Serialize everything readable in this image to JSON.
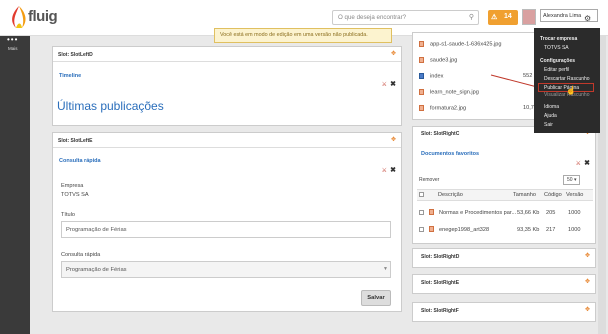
{
  "app": {
    "logo_text": "fluig"
  },
  "header": {
    "search_placeholder": "O que deseja encontrar?",
    "alerts_count": "14",
    "user_name": "Alexandra Lima"
  },
  "sidebar": {
    "dots": "•••",
    "label": "Mais"
  },
  "banner": {
    "text": "Você está em modo de edição em uma versão não publicada."
  },
  "slot_left_d": {
    "title": "Slot: SlotLeftD",
    "widget_title": "Timeline",
    "heading": "Últimas publicações"
  },
  "slot_left_e": {
    "title": "Slot: SlotLeftE",
    "widget_title": "Consulta rápida",
    "company_label": "Empresa",
    "company_value": "TOTVS SA",
    "title_label": "Título",
    "title_value": "Programação de Férias",
    "quick_label": "Consulta rápida",
    "quick_value": "Programação de Férias",
    "save_label": "Salvar"
  },
  "files": [
    "app-s1-saude-1-636x425.jpg",
    "saude3.jpg",
    "index",
    "learn_note_sign.jpg",
    "formatura2.jpg"
  ],
  "file_sizes": [
    "",
    "",
    "552",
    "",
    "10,7"
  ],
  "slot_right_c": {
    "title": "Slot: SlotRightC",
    "widget_title": "Documentos favoritos",
    "remove_label": "Remover",
    "page_size": "50",
    "columns": [
      "Descrição",
      "Tamanho",
      "Código",
      "Versão"
    ],
    "rows": [
      {
        "desc": "Normas e Procedimentos par...",
        "size": "53,66 Kb",
        "code": "205",
        "version": "1000"
      },
      {
        "desc": "enegep1998_art328",
        "size": "93,35 Kb",
        "code": "217",
        "version": "1000"
      }
    ]
  },
  "slot_right_d": {
    "title": "Slot: SlotRightD"
  },
  "slot_right_e": {
    "title": "Slot: SlotRightE"
  },
  "slot_right_f": {
    "title": "Slot: SlotRightF"
  },
  "menu": {
    "company_header": "Trocar empresa",
    "company": "TOTVS SA",
    "config_header": "Configurações",
    "items": [
      "Editar perfil",
      "Descartar Rascunho",
      "Publicar Página",
      "Visualizar Rascunho",
      "Idioma",
      "Ajuda",
      "Sair"
    ]
  }
}
